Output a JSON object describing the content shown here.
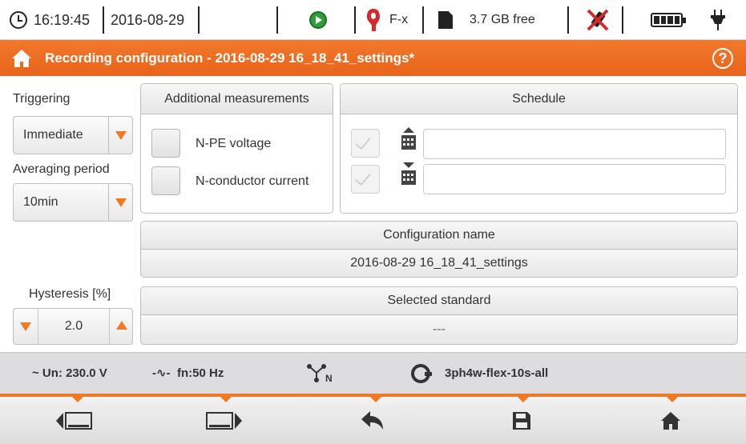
{
  "statusbar": {
    "time": "16:19:45",
    "date": "2016-08-29",
    "clamp_type": "F-x",
    "free_space": "3.7 GB free"
  },
  "titlebar": {
    "title": "Recording configuration - 2016-08-29 16_18_41_settings*"
  },
  "triggering": {
    "label": "Triggering",
    "value": "Immediate"
  },
  "averaging": {
    "label": "Averaging period",
    "value": "10min"
  },
  "hysteresis": {
    "label": "Hysteresis [%]",
    "value": "2.0"
  },
  "additional": {
    "title": "Additional measurements",
    "items": [
      {
        "label": "N-PE voltage",
        "checked": false
      },
      {
        "label": "N-conductor current",
        "checked": false
      }
    ]
  },
  "schedule": {
    "title": "Schedule",
    "start": "",
    "stop": ""
  },
  "config_name": {
    "title": "Configuration name",
    "value": "2016-08-29 16_18_41_settings"
  },
  "standard": {
    "title": "Selected standard",
    "value": "---"
  },
  "info": {
    "voltage": "~ Un: 230.0 V",
    "frequency": "fn:50 Hz",
    "connection": "N",
    "config": "3ph4w-flex-10s-all"
  },
  "colors": {
    "accent": "#f07a21",
    "title_bar": "#e8641a"
  },
  "bottom_nav": [
    "prev-screen-icon",
    "next-screen-icon",
    "back-icon",
    "save-icon",
    "home-icon"
  ]
}
